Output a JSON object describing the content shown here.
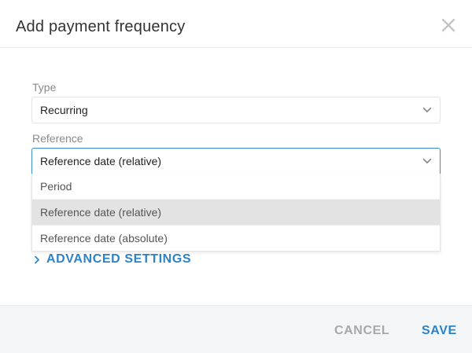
{
  "dialog": {
    "title": "Add payment frequency"
  },
  "type_field": {
    "label": "Type",
    "value": "Recurring"
  },
  "reference_field": {
    "label": "Reference",
    "value": "Reference date (relative)",
    "options": [
      {
        "label": "Period",
        "selected": false
      },
      {
        "label": "Reference date (relative)",
        "selected": true
      },
      {
        "label": "Reference date (absolute)",
        "selected": false
      }
    ]
  },
  "advanced": {
    "label": "ADVANCED SETTINGS"
  },
  "footer": {
    "cancel_label": "CANCEL",
    "save_label": "SAVE"
  },
  "colors": {
    "accent": "#2d82c9",
    "focus_border": "#3d8ecb",
    "selected_option_bg": "#e3e3e3",
    "muted_button": "#a8a8a8",
    "footer_bg": "#f4f5f7"
  },
  "icons": {
    "close": "close-icon",
    "select_arrow": "chevron-down-icon",
    "advanced_arrow": "chevron-right-icon"
  }
}
